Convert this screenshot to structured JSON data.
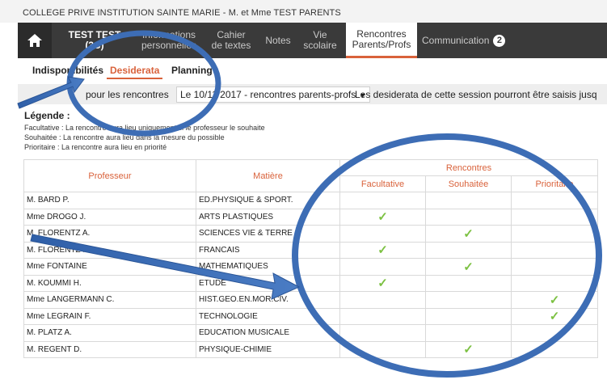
{
  "header": {
    "school": "COLLEGE PRIVE INSTITUTION SAINTE MARIE - M. et Mme TEST PARENTS"
  },
  "nav": {
    "user": "TEST TEST (3C)",
    "items": [
      {
        "line1": "Informations",
        "line2": "personnelles"
      },
      {
        "line1": "Cahier",
        "line2": "de textes"
      },
      {
        "line1": "Notes",
        "line2": ""
      },
      {
        "line1": "Vie",
        "line2": "scolaire"
      },
      {
        "line1": "Rencontres",
        "line2": "Parents/Profs"
      }
    ],
    "communication": "Communication",
    "communication_badge": "2"
  },
  "subtabs": [
    "Indisponibilités",
    "Desiderata",
    "Planning"
  ],
  "session": {
    "label": "pour les rencontres",
    "selected": "Le 10/11/2017 - rencontres parents-profs",
    "note": "Les desiderata de cette session pourront être saisis jusq"
  },
  "legend": {
    "title": "Légende :",
    "lines": [
      "Facultative : La rencontre aura lieu uniquement si le professeur le souhaite",
      "Souhaitée : La rencontre aura lieu dans la mesure du possible",
      "Prioritaire : La rencontre aura lieu en priorité"
    ]
  },
  "table": {
    "headers": {
      "professeur": "Professeur",
      "matiere": "Matière",
      "rencontres": "Rencontres",
      "facultative": "Facultative",
      "souhaitee": "Souhaitée",
      "prioritaire": "Prioritaire"
    },
    "rows": [
      {
        "prof": "M. BARD P.",
        "matiere": "ED.PHYSIQUE & SPORT.",
        "choice": ""
      },
      {
        "prof": "Mme DROGO J.",
        "matiere": "ARTS PLASTIQUES",
        "choice": "facultative"
      },
      {
        "prof": "M. FLORENTZ A.",
        "matiere": "SCIENCES VIE & TERRE",
        "choice": "souhaitee"
      },
      {
        "prof": "M. FLORENTZ N.",
        "matiere": "FRANCAIS",
        "choice": "facultative"
      },
      {
        "prof": "Mme FONTAINE",
        "matiere": "MATHEMATIQUES",
        "choice": "souhaitee"
      },
      {
        "prof": "M. KOUMMI H.",
        "matiere": "ETUDE",
        "choice": "facultative"
      },
      {
        "prof": "Mme LANGERMANN C.",
        "matiere": "HIST.GEO.EN.MOR.CIV.",
        "choice": "prioritaire"
      },
      {
        "prof": "Mme LEGRAIN F.",
        "matiere": "TECHNOLOGIE",
        "choice": "prioritaire"
      },
      {
        "prof": "M. PLATZ A.",
        "matiere": "EDUCATION MUSICALE",
        "choice": ""
      },
      {
        "prof": "M. REGENT D.",
        "matiere": "PHYSIQUE-CHIMIE",
        "choice": "souhaitee"
      }
    ],
    "check_glyph": "✓"
  },
  "colors": {
    "accent": "#d9623b",
    "nav_bg": "#3a3a3a",
    "check": "#7cc142",
    "annotation": "#3d6db5"
  },
  "icons": {
    "home": "home-icon",
    "check": "check-icon",
    "dropdown": "chevron-down-icon"
  }
}
